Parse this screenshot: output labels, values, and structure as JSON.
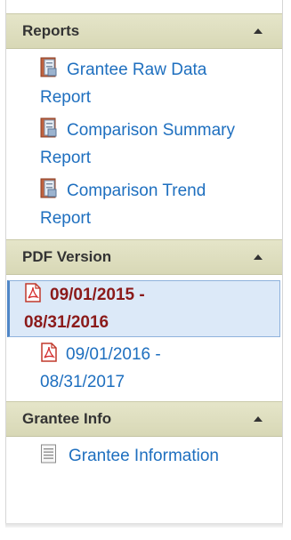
{
  "sections": {
    "reports": {
      "title": "Reports",
      "items": [
        {
          "line1": "Grantee Raw Data",
          "line2": "Report"
        },
        {
          "line1": "Comparison Summary",
          "line2": "Report"
        },
        {
          "line1": "Comparison Trend",
          "line2": "Report"
        }
      ]
    },
    "pdf": {
      "title": "PDF Version",
      "items": [
        {
          "line1": "09/01/2015 -",
          "line2": "08/31/2016"
        },
        {
          "line1": "09/01/2016 -",
          "line2": "08/31/2017"
        }
      ]
    },
    "grantee": {
      "title": "Grantee Info",
      "items": [
        {
          "line1": "Grantee Information"
        }
      ]
    }
  },
  "icons": {
    "report": "report-book-icon",
    "pdf": "pdf-file-icon",
    "info": "document-list-icon",
    "collapse": "caret-up-icon"
  },
  "colors": {
    "link": "#1e6fbf",
    "active_text": "#8b1a1a",
    "header_bg": "#e0e0c2",
    "active_bg": "#dce9f8"
  }
}
